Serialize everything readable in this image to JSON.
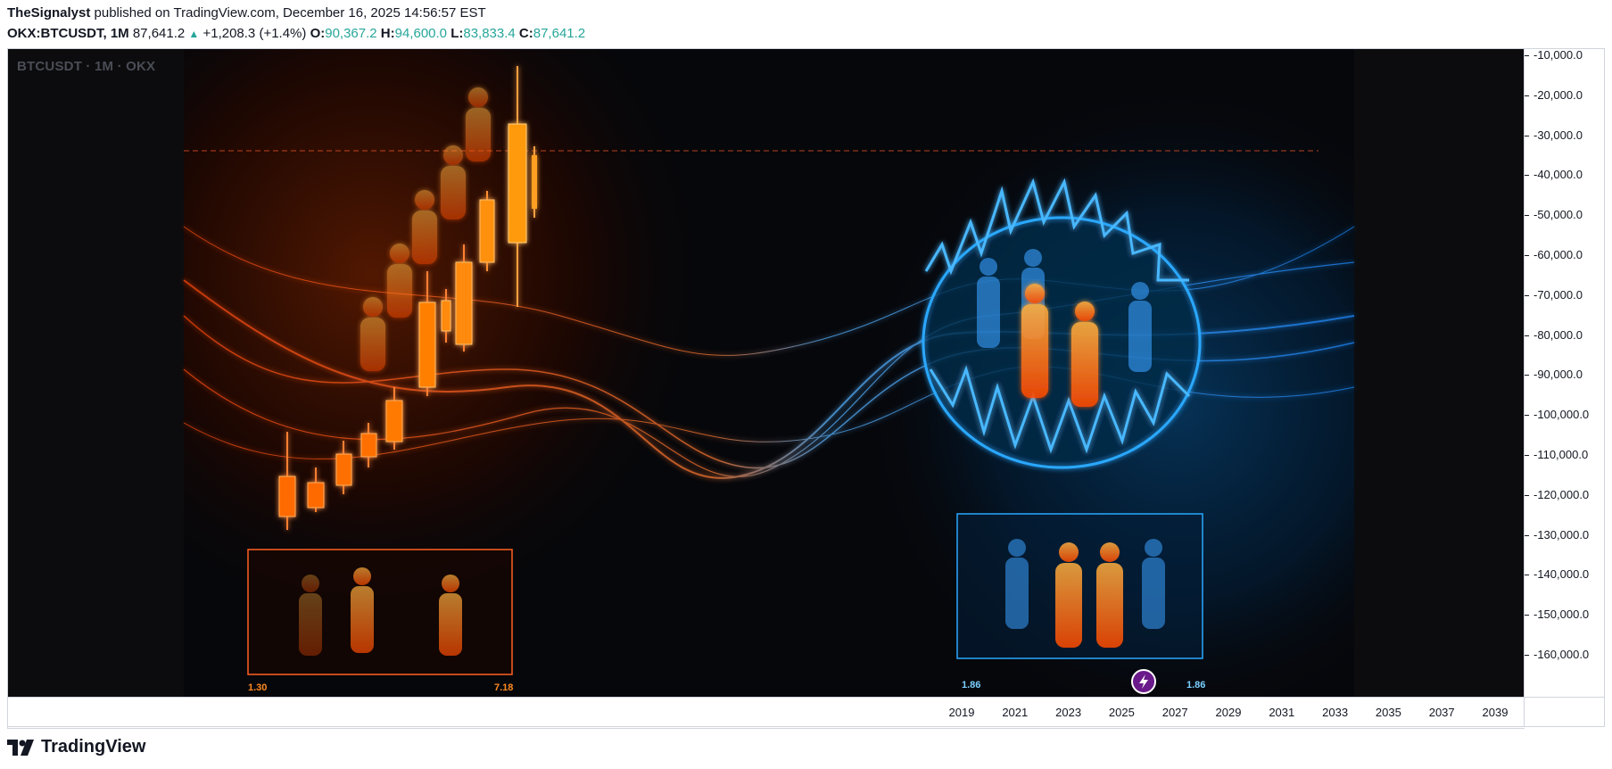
{
  "header": {
    "author": "TheSignalyst",
    "published_text": "published on TradingView.com, December 16, 2025 14:56:57 EST"
  },
  "ticker": {
    "symbol": "OKX:BTCUSDT, 1M",
    "last": "87,641.2",
    "change": "+1,208.3 (+1.4%)",
    "o_label": "O:",
    "o_value": "90,367.2",
    "h_label": "H:",
    "h_value": "94,600.0",
    "l_label": "L:",
    "l_value": "83,833.4",
    "c_label": "C:",
    "c_value": "87,641.2"
  },
  "watermark": "BTCUSDT · 1M · OKX",
  "artwork_labels": {
    "left_a": "1.30",
    "left_b": "7.18",
    "right_a": "1.86",
    "right_b": "1.86"
  },
  "y_axis": [
    "-10,000.0",
    "-20,000.0",
    "-30,000.0",
    "-40,000.0",
    "-50,000.0",
    "-60,000.0",
    "-70,000.0",
    "-80,000.0",
    "-90,000.0",
    "-100,000.0",
    "-110,000.0",
    "-120,000.0",
    "-130,000.0",
    "-140,000.0",
    "-150,000.0",
    "-160,000.0"
  ],
  "x_axis": [
    "2019",
    "2021",
    "2023",
    "2025",
    "2027",
    "2029",
    "2031",
    "2033",
    "2035",
    "2037",
    "2039"
  ],
  "brand": "TradingView",
  "colors": {
    "accent_up": "#26a69a",
    "fire": "#ff6a00",
    "ice": "#1e9bff"
  }
}
